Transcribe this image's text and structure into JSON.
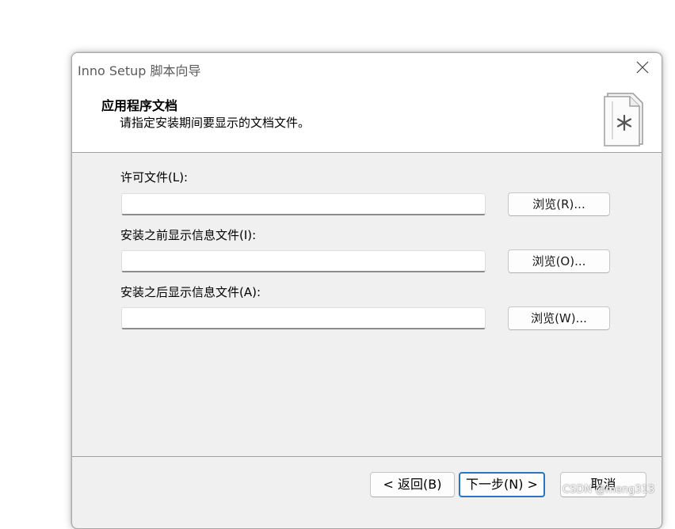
{
  "window": {
    "title": "Inno Setup 脚本向导"
  },
  "header": {
    "title": "应用程序文档",
    "subtitle": "请指定安装期间要显示的文档文件。",
    "icon": "document-icon"
  },
  "fields": [
    {
      "label": "许可文件(L):",
      "value": "",
      "placeholder": "",
      "browse_label": "浏览(R)..."
    },
    {
      "label": "安装之前显示信息文件(I):",
      "value": "",
      "placeholder": "",
      "browse_label": "浏览(O)..."
    },
    {
      "label": "安装之后显示信息文件(A):",
      "value": "",
      "placeholder": "",
      "browse_label": "浏览(W)..."
    }
  ],
  "footer": {
    "back_label": "< 返回(B)",
    "next_label": "下一步(N) >",
    "cancel_label": "取消"
  },
  "watermark": "CSDN @meng313",
  "colors": {
    "window_bg": "#f0f0f0",
    "panel_bg": "#ffffff",
    "primary_border": "#2a74c4",
    "title_text": "#5c5c5c"
  }
}
